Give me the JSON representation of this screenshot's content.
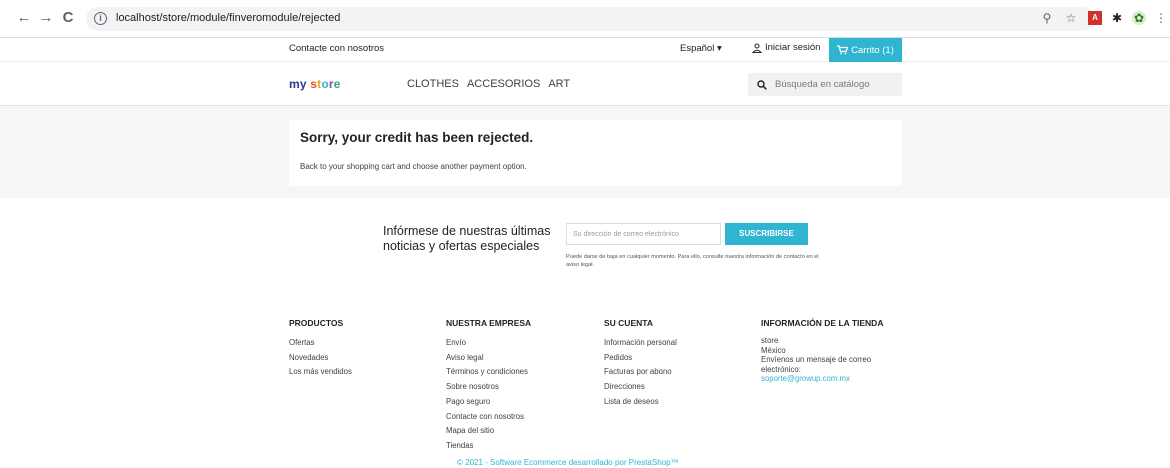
{
  "browser": {
    "url": "localhost/store/module/finveromodule/rejected"
  },
  "header": {
    "contact": "Contacte con nosotros",
    "language": "Español",
    "login": "Iniciar sesión",
    "cart": "Carrito (1)",
    "logo_text": "my store",
    "menu": [
      "CLOTHES",
      "ACCESORIOS",
      "ART"
    ],
    "search_placeholder": "Búsqueda en catálogo"
  },
  "content": {
    "title": "Sorry, your credit has been rejected.",
    "text": "Back to your shopping cart and choose another payment option."
  },
  "newsletter": {
    "title": "Infórmese de nuestras últimas noticias y ofertas especiales",
    "placeholder": "Su dirección de correo electrónico",
    "button": "SUSCRIBIRSE",
    "note": "Puede darse de baja en cualquier momento. Para ello, consulte nuestra información de contacto en el aviso legal."
  },
  "footer": {
    "productos": {
      "title": "PRODUCTOS",
      "links": [
        "Ofertas",
        "Novedades",
        "Los más vendidos"
      ]
    },
    "empresa": {
      "title": "NUESTRA EMPRESA",
      "links": [
        "Envío",
        "Aviso legal",
        "Términos y condiciones",
        "Sobre nosotros",
        "Pago seguro",
        "Contacte con nosotros",
        "Mapa del sitio",
        "Tiendas"
      ]
    },
    "cuenta": {
      "title": "SU CUENTA",
      "links": [
        "Información personal",
        "Pedidos",
        "Facturas por abono",
        "Direcciones",
        "Lista de deseos"
      ]
    },
    "tienda": {
      "title": "INFORMACIÓN DE LA TIENDA",
      "lines": [
        "store",
        "México",
        "Envíenos un mensaje de correo electrónico:"
      ],
      "email": "soporte@growup.com.mx"
    },
    "copyright": "© 2021 - Software Ecommerce desarrollado por PrestaShop™"
  },
  "colors": {
    "accent": "#2fb5d2",
    "background_band": "#f6f6f6"
  }
}
